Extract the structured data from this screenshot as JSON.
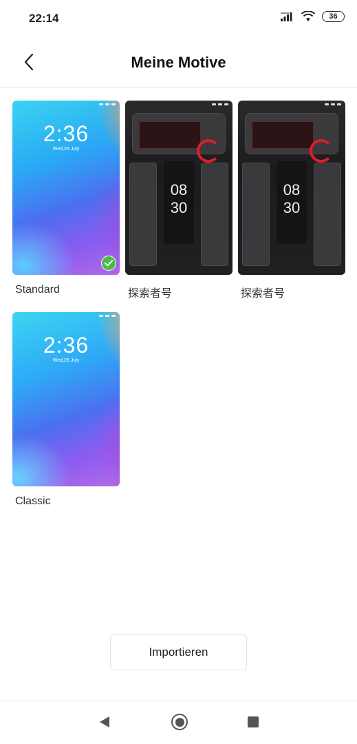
{
  "status_bar": {
    "time": "22:14",
    "battery": "36"
  },
  "header": {
    "title": "Meine Motive"
  },
  "themes": [
    {
      "label": "Standard",
      "style": "standard",
      "lock_time": "2:36",
      "lock_date": "Wed,26 July",
      "selected": true
    },
    {
      "label": "探索者号",
      "style": "explorer",
      "time_hours": "08",
      "time_minutes": "30",
      "selected": false
    },
    {
      "label": "探索者号",
      "style": "explorer",
      "time_hours": "08",
      "time_minutes": "30",
      "selected": false
    },
    {
      "label": "Classic",
      "style": "classic",
      "lock_time": "2:36",
      "lock_date": "Wed,26 July",
      "selected": false
    }
  ],
  "import_button": {
    "label": "Importieren"
  },
  "colors": {
    "selected_check": "#4cb84c",
    "accent_red": "#e01b2c"
  },
  "icons": {
    "back": "chevron-left-icon",
    "nav_back": "triangle-back-icon",
    "nav_home": "circle-home-icon",
    "nav_recent": "square-recent-icon"
  }
}
